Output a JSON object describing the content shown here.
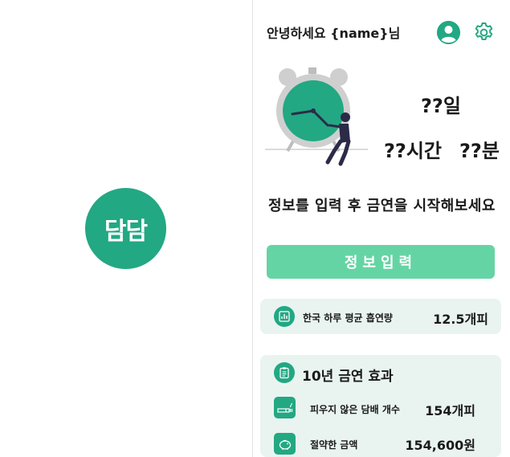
{
  "splash": {
    "logo_text": "담담"
  },
  "home": {
    "greeting": "안녕하세요 {name}님",
    "icons": {
      "profile": "account-circle-icon",
      "settings": "gear-icon",
      "illustration": "clock-person-illustration"
    },
    "timer": {
      "days": "??일",
      "hours": "??시간",
      "minutes": "??분"
    },
    "prompt": "정보를 입력 후 금연을 시작해보세요",
    "input_button": "정보입력",
    "average_card": {
      "icon": "bar-chart-icon",
      "label": "한국 하루 평균 흡연량",
      "value": "12.5개피"
    },
    "effect_card": {
      "icon": "clipboard-icon",
      "title": "10년 금연 효과",
      "rows": [
        {
          "icon": "cigarette-icon",
          "label": "피우지 않은 담배 개수",
          "value": "154개피"
        },
        {
          "icon": "piggy-bank-icon",
          "label": "절약한 금액",
          "value": "154,600원"
        }
      ]
    }
  },
  "colors": {
    "brand": "#22a883",
    "button": "#65d4a4",
    "card": "#e9f4f0"
  }
}
